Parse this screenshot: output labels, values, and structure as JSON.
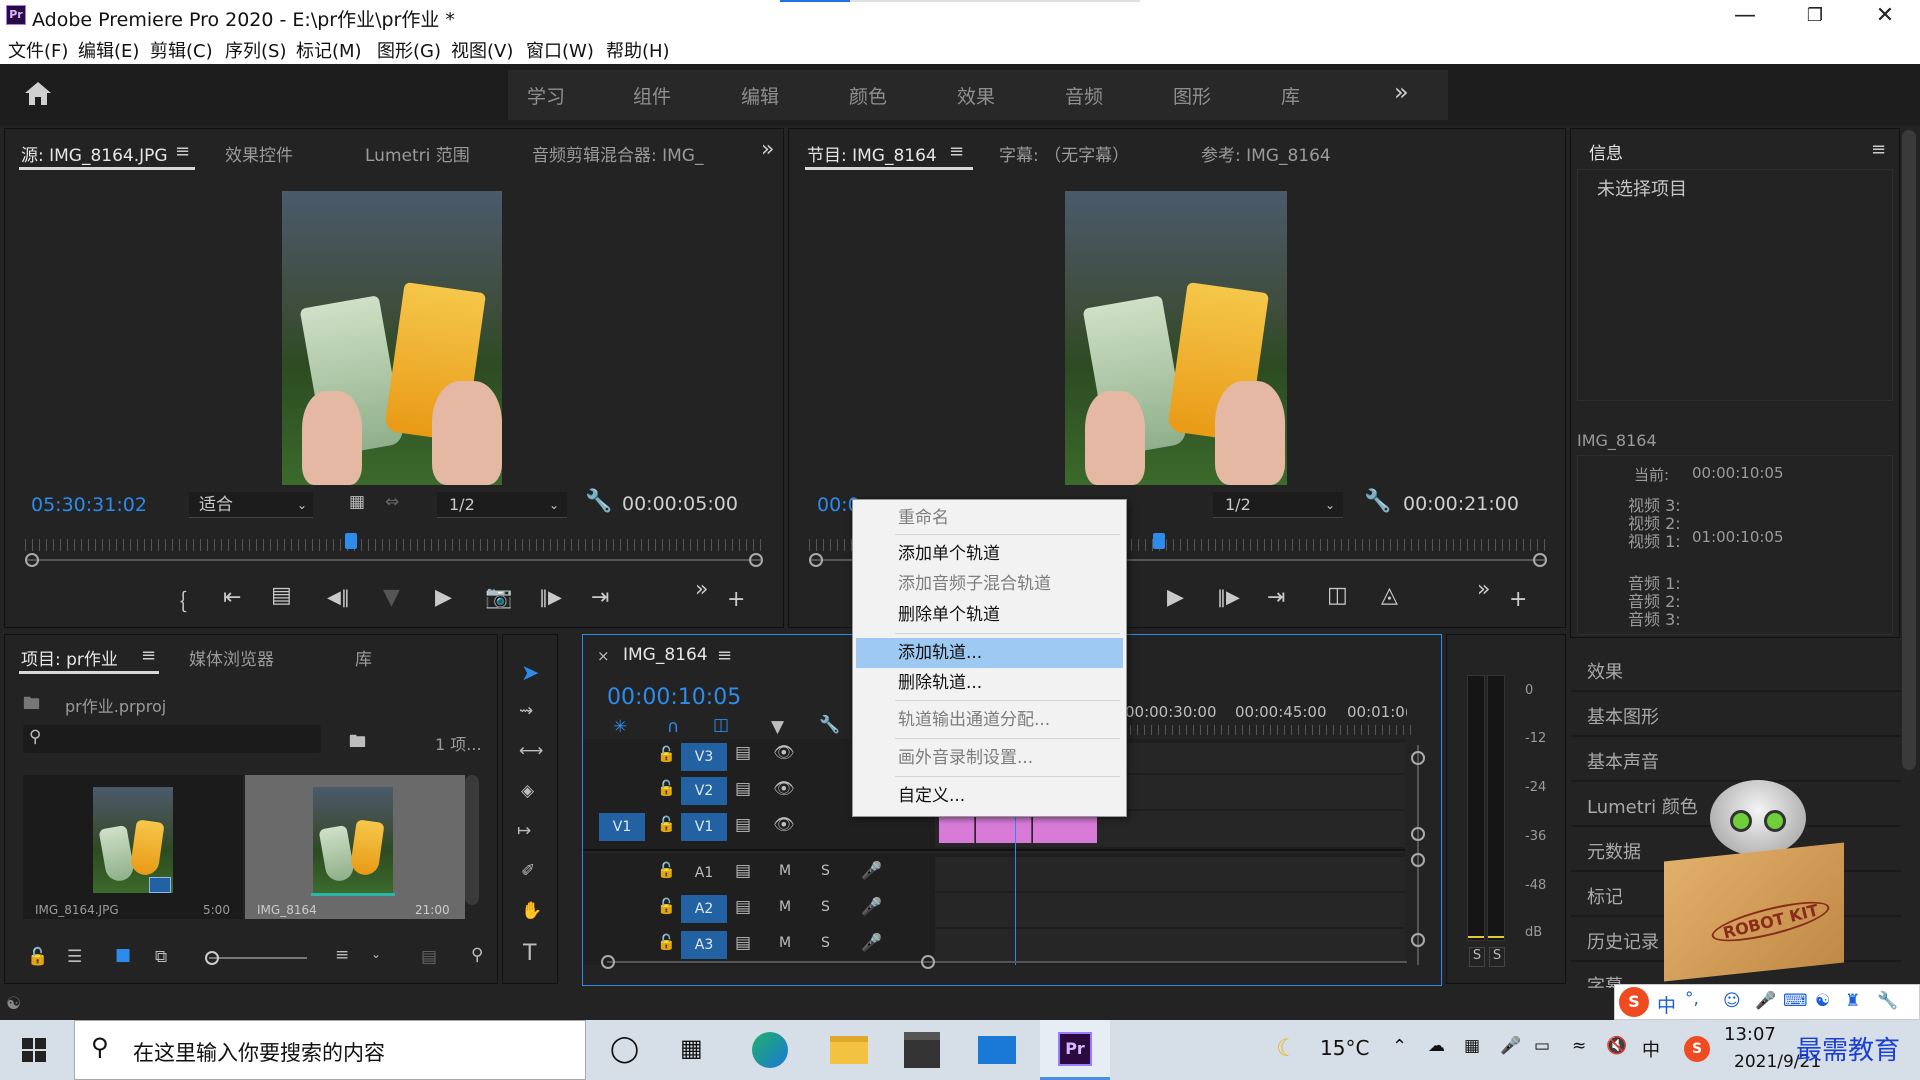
{
  "window": {
    "app_icon": "Pr",
    "title": "Adobe Premiere Pro 2020 - E:\\pr作业\\pr作业 *",
    "minimize_icon": "minimize-icon",
    "restore_icon": "restore-icon",
    "close_icon": "close-icon"
  },
  "menu": [
    "文件(F)",
    "编辑(E)",
    "剪辑(C)",
    "序列(S)",
    "标记(M)",
    "图形(G)",
    "视图(V)",
    "窗口(W)",
    "帮助(H)"
  ],
  "workspaces": [
    "学习",
    "组件",
    "编辑",
    "颜色",
    "效果",
    "音频",
    "图形",
    "库"
  ],
  "workspaces_more": "»",
  "source_panel": {
    "tabs": [
      "源: IMG_8164.JPG",
      "效果控件",
      "Lumetri 范围",
      "音频剪辑混合器: IMG_"
    ],
    "more": "»",
    "timecode": "05:30:31:02",
    "zoom": "适合",
    "resolution": "1/2",
    "duration": "00:00:05:00",
    "settings_icon": "wrench-icon",
    "ruler_marker": 0.44,
    "transport": [
      "mark-in-icon",
      "go-to-in-icon",
      "insert-icon",
      "step-back-icon",
      "marker-icon",
      "play-icon",
      "export-frame-icon",
      "step-forward-icon",
      "overwrite-icon"
    ]
  },
  "program_panel": {
    "tabs": [
      "节目: IMG_8164",
      "字幕: （无字幕）",
      "参考: IMG_8164"
    ],
    "timecode_partial": "00:0",
    "resolution": "1/2",
    "duration": "00:00:21:00",
    "settings_icon": "wrench-icon",
    "transport": [
      "play-icon",
      "step-forward-icon",
      "go-to-out-icon",
      "lift-icon",
      "extract-icon"
    ]
  },
  "context_menu": {
    "items": [
      {
        "label": "重命名",
        "enabled": false,
        "highlighted": false
      },
      {
        "label": "添加单个轨道",
        "enabled": true,
        "highlighted": false
      },
      {
        "label": "添加音频子混合轨道",
        "enabled": false,
        "highlighted": false
      },
      {
        "label": "删除单个轨道",
        "enabled": true,
        "highlighted": false
      },
      {
        "label": "添加轨道...",
        "enabled": true,
        "highlighted": true
      },
      {
        "label": "删除轨道...",
        "enabled": true,
        "highlighted": false
      },
      {
        "label": "轨道输出通道分配...",
        "enabled": false,
        "highlighted": false
      },
      {
        "label": "画外音录制设置...",
        "enabled": false,
        "highlighted": false
      },
      {
        "label": "自定义...",
        "enabled": true,
        "highlighted": false
      }
    ]
  },
  "project_panel": {
    "tabs": [
      "项目: pr作业",
      "媒体浏览器",
      "库"
    ],
    "file": "pr作业.prproj",
    "count": "1 项...",
    "search_icon": "search-icon",
    "items": [
      {
        "name": "IMG_8164.JPG",
        "duration": "5:00",
        "selected": false
      },
      {
        "name": "IMG_8164",
        "duration": "21:00",
        "selected": true
      }
    ]
  },
  "tools": [
    "selection-tool-icon",
    "track-select-icon",
    "ripple-edit-icon",
    "razor-icon",
    "slip-icon",
    "pen-icon",
    "hand-icon",
    "type-icon"
  ],
  "timeline": {
    "close": "×",
    "sequence": "IMG_8164",
    "timecode": "00:00:10:05",
    "ruler_labels": [
      "00:00:30:00",
      "00:00:45:00",
      "00:01:0("
    ],
    "video_tracks": [
      {
        "source": "",
        "name": "V3",
        "lock": "lock-icon",
        "sync": "sync-icon",
        "eye": "eye-icon"
      },
      {
        "source": "",
        "name": "V2",
        "lock": "lock-icon",
        "sync": "sync-icon",
        "eye": "eye-icon"
      },
      {
        "source": "V1",
        "name": "V1",
        "lock": "lock-icon",
        "sync": "sync-icon",
        "eye": "eye-icon"
      }
    ],
    "audio_tracks": [
      {
        "name": "A1",
        "m": "M",
        "s": "S",
        "mic": "mic-icon"
      },
      {
        "name": "A2",
        "m": "M",
        "s": "S",
        "mic": "mic-icon"
      },
      {
        "name": "A3",
        "m": "M",
        "s": "S",
        "mic": "mic-icon"
      }
    ]
  },
  "audio_meter": {
    "labels": [
      "0",
      "-12",
      "-24",
      "-36",
      "-48",
      "dB"
    ],
    "solo": [
      "S",
      "S"
    ]
  },
  "info_panel": {
    "title": "信息",
    "none_selected": "未选择项目",
    "clip": "IMG_8164",
    "current_label": "当前:",
    "current_value": "00:00:10:05",
    "video": [
      "视频 3:",
      "视频 2:",
      "视频 1:"
    ],
    "video1_value": "01:00:10:05",
    "audio": [
      "音频 1:",
      "音频 2:",
      "音频 3:"
    ]
  },
  "right_panels": [
    "效果",
    "基本图形",
    "基本声音",
    "Lumetri 颜色",
    "元数据",
    "标记",
    "历史记录",
    "字幕"
  ],
  "watermark": {
    "box_text": "ROBOT KIT",
    "site": "最需教育"
  },
  "ime_bar": {
    "lang": "中",
    "punct": "°,"
  },
  "taskbar": {
    "search_placeholder": "在这里输入你要搜索的内容",
    "weather": "15°C",
    "ime": "中",
    "time": "13:07",
    "date": "2021/9/21"
  }
}
